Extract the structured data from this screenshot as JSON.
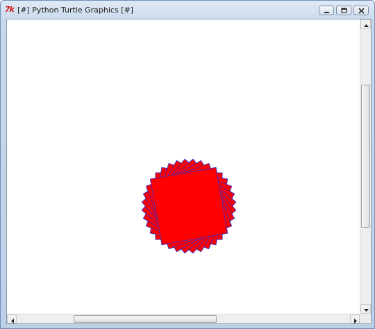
{
  "window": {
    "title": "[#] Python Turtle Graphics [#]",
    "app_icon_text": "7k",
    "buttons": {
      "minimize": "minimize",
      "maximize": "maximize",
      "close": "close"
    }
  },
  "canvas": {
    "background": "#ffffff",
    "drawing": {
      "description_shape": "star-like red polygon ring with blue turtle trace",
      "fill_color": "#ff0000",
      "stroke_color": "#3b2bc8",
      "edge_color": "#8b1a3a",
      "repetitions": 36
    }
  },
  "scrollbars": {
    "vertical": {
      "position": 0.42,
      "visible_fraction": 0.52
    },
    "horizontal": {
      "position": 0.3,
      "visible_fraction": 0.43
    }
  }
}
